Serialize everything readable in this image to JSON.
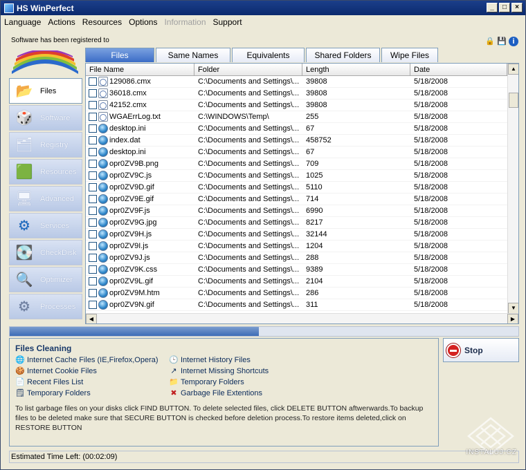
{
  "window": {
    "title": "HS WinPerfect"
  },
  "menu": [
    "Language",
    "Actions",
    "Resources",
    "Options",
    "Information",
    "Support"
  ],
  "menu_disabled": "Information",
  "register_text": "Software has been registered to",
  "sidebar": [
    {
      "label": "Files",
      "icon": "folder-icon"
    },
    {
      "label": "Software",
      "icon": "boxes-icon"
    },
    {
      "label": "Registry",
      "icon": "registry-icon"
    },
    {
      "label": "Resources",
      "icon": "memory-icon"
    },
    {
      "label": "Advanced",
      "icon": "computer-icon"
    },
    {
      "label": "Services",
      "icon": "gear-icon"
    },
    {
      "label": "CheckDisk",
      "icon": "disk-icon"
    },
    {
      "label": "Optimizer",
      "icon": "magnifier-icon"
    },
    {
      "label": "Processes",
      "icon": "gears-icon"
    }
  ],
  "tabs": [
    "Files",
    "Same Names",
    "Equivalents",
    "Shared Folders",
    "Wipe Files"
  ],
  "columns": [
    "File Name",
    "Folder",
    "Length",
    "Date"
  ],
  "rows": [
    {
      "name": "129086.cmx",
      "folder": "C:\\Documents and Settings\\...",
      "length": "39808",
      "date": "5/18/2008",
      "icon": "doc"
    },
    {
      "name": "36018.cmx",
      "folder": "C:\\Documents and Settings\\...",
      "length": "39808",
      "date": "5/18/2008",
      "icon": "doc"
    },
    {
      "name": "42152.cmx",
      "folder": "C:\\Documents and Settings\\...",
      "length": "39808",
      "date": "5/18/2008",
      "icon": "doc"
    },
    {
      "name": "WGAErrLog.txt",
      "folder": "C:\\WINDOWS\\Temp\\",
      "length": "255",
      "date": "5/18/2008",
      "icon": "doc"
    },
    {
      "name": "desktop.ini",
      "folder": "C:\\Documents and Settings\\...",
      "length": "67",
      "date": "5/18/2008",
      "icon": "globe"
    },
    {
      "name": "index.dat",
      "folder": "C:\\Documents and Settings\\...",
      "length": "458752",
      "date": "5/18/2008",
      "icon": "globe"
    },
    {
      "name": "desktop.ini",
      "folder": "C:\\Documents and Settings\\...",
      "length": "67",
      "date": "5/18/2008",
      "icon": "globe"
    },
    {
      "name": "opr0ZV9B.png",
      "folder": "C:\\Documents and Settings\\...",
      "length": "709",
      "date": "5/18/2008",
      "icon": "globe"
    },
    {
      "name": "opr0ZV9C.js",
      "folder": "C:\\Documents and Settings\\...",
      "length": "1025",
      "date": "5/18/2008",
      "icon": "globe"
    },
    {
      "name": "opr0ZV9D.gif",
      "folder": "C:\\Documents and Settings\\...",
      "length": "5110",
      "date": "5/18/2008",
      "icon": "globe"
    },
    {
      "name": "opr0ZV9E.gif",
      "folder": "C:\\Documents and Settings\\...",
      "length": "714",
      "date": "5/18/2008",
      "icon": "globe"
    },
    {
      "name": "opr0ZV9F.js",
      "folder": "C:\\Documents and Settings\\...",
      "length": "6990",
      "date": "5/18/2008",
      "icon": "globe"
    },
    {
      "name": "opr0ZV9G.jpg",
      "folder": "C:\\Documents and Settings\\...",
      "length": "8217",
      "date": "5/18/2008",
      "icon": "globe"
    },
    {
      "name": "opr0ZV9H.js",
      "folder": "C:\\Documents and Settings\\...",
      "length": "32144",
      "date": "5/18/2008",
      "icon": "globe"
    },
    {
      "name": "opr0ZV9I.js",
      "folder": "C:\\Documents and Settings\\...",
      "length": "1204",
      "date": "5/18/2008",
      "icon": "globe"
    },
    {
      "name": "opr0ZV9J.js",
      "folder": "C:\\Documents and Settings\\...",
      "length": "288",
      "date": "5/18/2008",
      "icon": "globe"
    },
    {
      "name": "opr0ZV9K.css",
      "folder": "C:\\Documents and Settings\\...",
      "length": "9389",
      "date": "5/18/2008",
      "icon": "globe"
    },
    {
      "name": "opr0ZV9L.gif",
      "folder": "C:\\Documents and Settings\\...",
      "length": "2104",
      "date": "5/18/2008",
      "icon": "globe"
    },
    {
      "name": "opr0ZV9M.htm",
      "folder": "C:\\Documents and Settings\\...",
      "length": "286",
      "date": "5/18/2008",
      "icon": "globe"
    },
    {
      "name": "opr0ZV9N.gif",
      "folder": "C:\\Documents and Settings\\...",
      "length": "311",
      "date": "5/18/2008",
      "icon": "globe"
    }
  ],
  "progress_fraction": 0.49,
  "cleaning": {
    "title": "Files Cleaning",
    "items": [
      {
        "label": "Internet Cache Files (IE,Firefox,Opera)",
        "icon": "globe-icon"
      },
      {
        "label": "Internet History Files",
        "icon": "clock-icon"
      },
      {
        "label": "Internet Cookie Files",
        "icon": "cookie-icon"
      },
      {
        "label": "Internet Missing Shortcuts",
        "icon": "shortcut-icon"
      },
      {
        "label": "Recent Files List",
        "icon": "document-icon"
      },
      {
        "label": "Temporary Folders",
        "icon": "folder-icon"
      },
      {
        "label": "Temporary Folders",
        "icon": "temp-icon"
      },
      {
        "label": "Garbage File Extentions",
        "icon": "delete-icon"
      }
    ],
    "description": "To list garbage files on your disks click FIND BUTTON. To delete selected files, click DELETE BUTTON aftwerwards.To backup files to be deleted make sure that SECURE BUTTON is checked before deletion process.To restore items deleted,click on RESTORE BUTTON"
  },
  "stop_label": "Stop",
  "status": "Estimated Time Left: (00:02:09)",
  "watermark": "INSTALUJ.CZ"
}
